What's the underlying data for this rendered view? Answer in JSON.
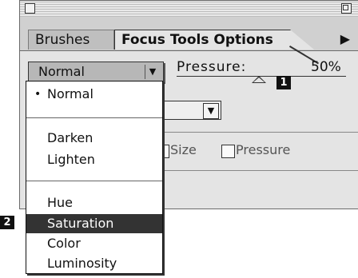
{
  "palette": {
    "tabs": [
      {
        "label": "Brushes"
      },
      {
        "label": "Focus Tools Options"
      }
    ],
    "menu_arrow": "▶"
  },
  "options": {
    "mode_value": "Normal",
    "dropdown_arrow": "▼",
    "pressure_label": "Pressure:",
    "pressure_value": "50%",
    "pressure_level": 0.5,
    "checkboxes": [
      {
        "label": "Size",
        "checked": false
      },
      {
        "label": "Pressure",
        "checked": false
      }
    ]
  },
  "callouts": [
    "1",
    "2"
  ],
  "mode_menu": {
    "current_marker": "•",
    "groups": [
      [
        "Normal"
      ],
      [
        "Darken",
        "Lighten"
      ],
      [
        "Hue",
        "Saturation",
        "Color",
        "Luminosity"
      ]
    ],
    "current": "Normal",
    "highlighted": "Saturation"
  }
}
